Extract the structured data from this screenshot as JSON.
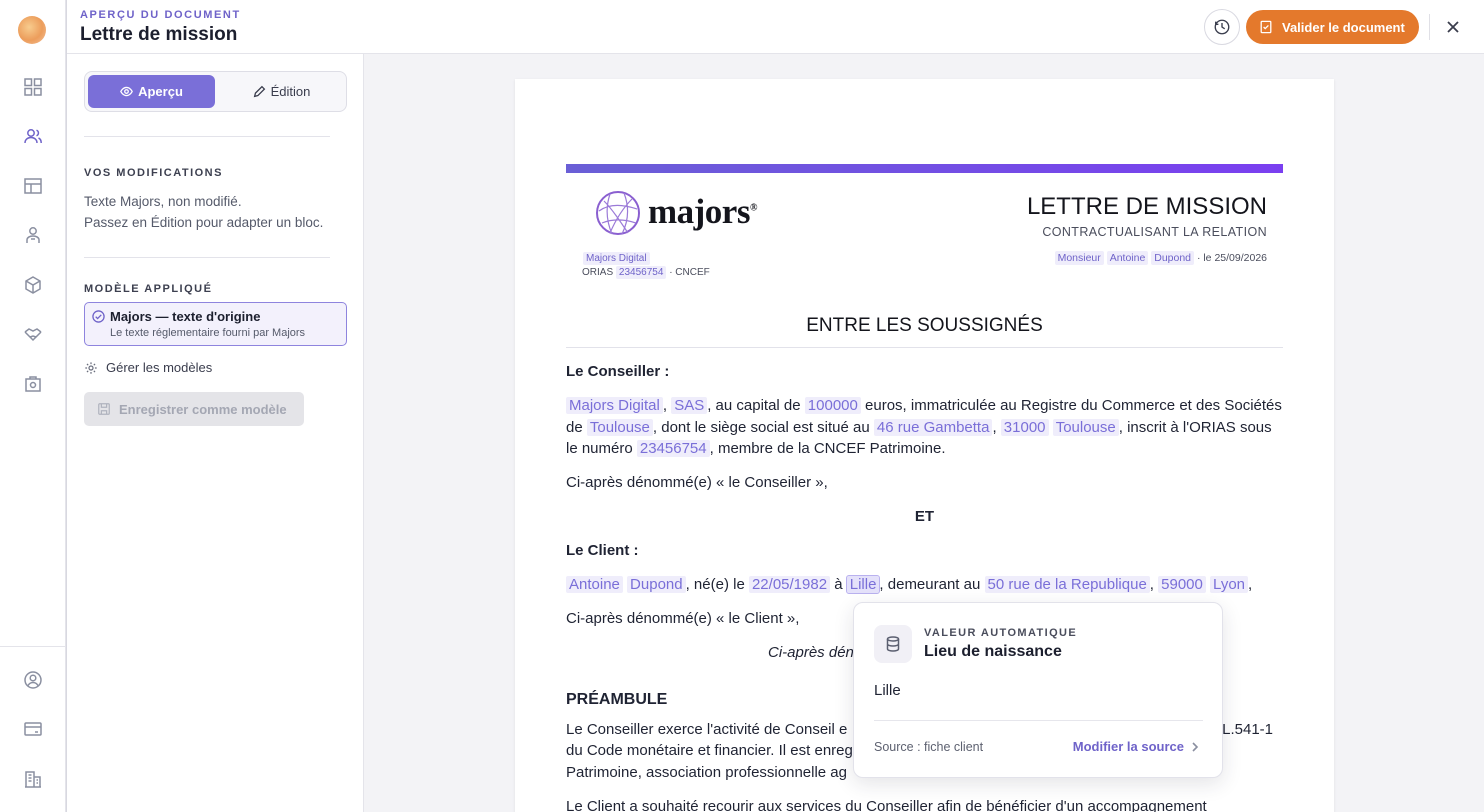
{
  "header": {
    "kicker": "APERÇU DU DOCUMENT",
    "title": "Lettre de mission",
    "validate_label": "Valider le document"
  },
  "sidebar": {
    "tabs": [
      {
        "label": "Aperçu",
        "active": true
      },
      {
        "label": "Édition",
        "active": false
      }
    ],
    "modifications_label": "VOS MODIFICATIONS",
    "modifications_line1": "Texte Majors, non modifié.",
    "modifications_line2": "Passez en Édition pour adapter un bloc.",
    "model_label": "MODÈLE APPLIQUÉ",
    "model_title": "Majors — texte d'origine",
    "model_subtitle": "Le texte réglementaire fourni par Majors",
    "manage_label": "Gérer les modèles",
    "save_label": "Enregistrer comme modèle"
  },
  "document": {
    "brand": "majors",
    "brand_mark": "®",
    "firm_name": "Majors Digital",
    "orias_prefix": "ORIAS",
    "orias_number": "23456754",
    "orias_suffix": "· CNCEF",
    "title": "LETTRE DE MISSION",
    "subtitle": "CONTRACTUALISANT LA RELATION",
    "meta_civility": "Monsieur",
    "meta_first": "Antoine",
    "meta_last": "Dupond",
    "meta_date": "· le 25/09/2026",
    "section1": "ENTRE LES SOUSSIGNÉS",
    "conseiller_head": "Le Conseiller :",
    "c_name": "Majors Digital",
    "c_form": "SAS",
    "c_t1": ", au capital de",
    "c_capital": "100000",
    "c_t2": "euros, immatriculée au Registre du Commerce et des Sociétés de",
    "c_city": "Toulouse",
    "c_t3": ", dont le siège social est situé au",
    "c_street": "46 rue Gambetta",
    "c_zip": "31000",
    "c_city2": "Toulouse",
    "c_t4": ", inscrit à l'ORIAS sous le numéro",
    "c_orias": "23456754",
    "c_t5": ", membre de la CNCEF Patrimoine.",
    "c_after": "Ci-après dénommé(e) « le Conseiller »,",
    "et": "ET",
    "client_head": "Le Client :",
    "cl_first": "Antoine",
    "cl_last": "Dupond",
    "cl_t1": ", né(e) le",
    "cl_birth": "22/05/1982",
    "cl_t2": "à",
    "cl_place": "Lille",
    "cl_t3": ", demeurant au",
    "cl_street": "50 rue de la Republique",
    "cl_zip": "59000",
    "cl_city": "Lyon",
    "cl_after": "Ci-après dénommé(e) « le Client »,",
    "joint": "Ci-après dén",
    "preambule_head": "PRÉAMBULE",
    "pre_line1a": "Le Conseiller exerce l'activité de Conseil e",
    "pre_line1b": "L.541-1",
    "pre_line2": "du Code monétaire et financier. Il est enreg",
    "pre_line3": "Patrimoine, association professionnelle ag",
    "pre_line4": "Le Client a souhaité recourir aux services du Conseiller afin de bénéficier d'un accompagnement"
  },
  "popover": {
    "kicker": "VALEUR AUTOMATIQUE",
    "title": "Lieu de naissance",
    "value": "Lille",
    "source": "Source : fiche client",
    "link": "Modifier la source"
  },
  "colors": {
    "accent": "#7a6fd8",
    "primary_action": "#e4792c",
    "variable_bg": "#efedfb"
  }
}
